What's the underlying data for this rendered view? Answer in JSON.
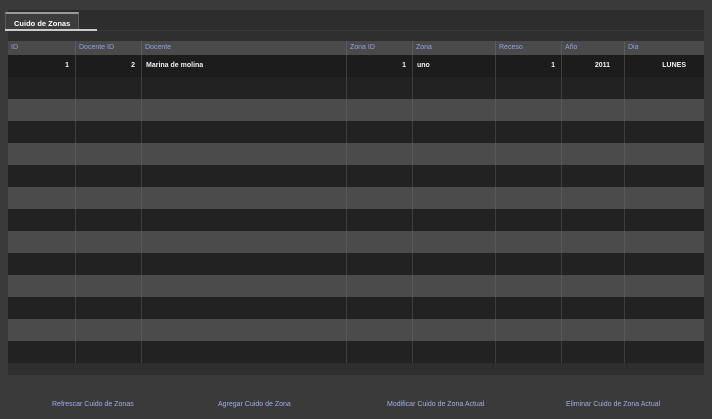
{
  "tab": {
    "label": "Cuido de Zonas"
  },
  "table": {
    "columns": [
      "ID",
      "Docente ID",
      "Docente",
      "Zona ID",
      "Zona",
      "Receso",
      "Año",
      "Dia"
    ],
    "rows": [
      [
        "1",
        "2",
        "Marina de molina",
        "1",
        "uno",
        "1",
        "2011",
        "LUNES"
      ]
    ],
    "empty_rows": 13
  },
  "footer": {
    "refresh_label": "Refrescar Cuido de Zonas",
    "add_label": "Agregar Cuido de Zona",
    "modify_label": "Modificar Cuido de Zona Actual",
    "delete_label": "Eliminar Cuido de Zona Actual"
  },
  "colors": {
    "background": "#3a3a3a",
    "header_text": "#8fa3e6",
    "button_text": "#9db0e8"
  }
}
